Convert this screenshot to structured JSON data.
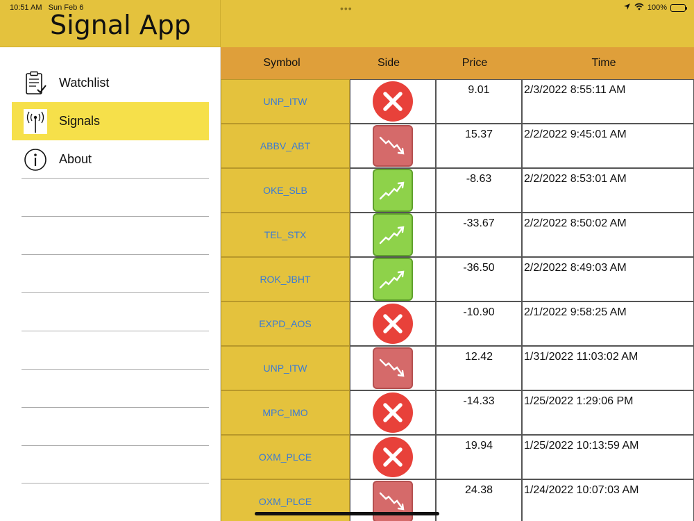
{
  "status_bar": {
    "time": "10:51 AM",
    "date": "Sun Feb 6",
    "battery": "100%"
  },
  "app": {
    "title": "Signal App"
  },
  "sidebar": {
    "items": [
      {
        "label": "Watchlist",
        "icon": "clipboard-icon",
        "active": false
      },
      {
        "label": "Signals",
        "icon": "signal-tower-icon",
        "active": true
      },
      {
        "label": "About",
        "icon": "info-icon",
        "active": false
      }
    ]
  },
  "table": {
    "columns": [
      "Symbol",
      "Side",
      "Price",
      "Time"
    ],
    "rows": [
      {
        "symbol": "UNP_ITW",
        "side": "close",
        "price": "9.01",
        "time": "2/3/2022 8:55:11 AM"
      },
      {
        "symbol": "ABBV_ABT",
        "side": "down",
        "price": "15.37",
        "time": "2/2/2022 9:45:01 AM"
      },
      {
        "symbol": "OKE_SLB",
        "side": "up",
        "price": "-8.63",
        "time": "2/2/2022 8:53:01 AM"
      },
      {
        "symbol": "TEL_STX",
        "side": "up",
        "price": "-33.67",
        "time": "2/2/2022 8:50:02 AM"
      },
      {
        "symbol": "ROK_JBHT",
        "side": "up",
        "price": "-36.50",
        "time": "2/2/2022 8:49:03 AM"
      },
      {
        "symbol": "EXPD_AOS",
        "side": "close",
        "price": "-10.90",
        "time": "2/1/2022 9:58:25 AM"
      },
      {
        "symbol": "UNP_ITW",
        "side": "down",
        "price": "12.42",
        "time": "1/31/2022 11:03:02 AM"
      },
      {
        "symbol": "MPC_IMO",
        "side": "close",
        "price": "-14.33",
        "time": "1/25/2022 1:29:06 PM"
      },
      {
        "symbol": "OXM_PLCE",
        "side": "close",
        "price": "19.94",
        "time": "1/25/2022 10:13:59 AM"
      },
      {
        "symbol": "OXM_PLCE",
        "side": "down",
        "price": "24.38",
        "time": "1/24/2022 10:07:03 AM"
      }
    ]
  },
  "colors": {
    "header": "#e4c23d",
    "table_header": "#df9f3a",
    "active_nav": "#f6e04a",
    "symbol_link": "#3a7bd5",
    "close_red": "#e8413a",
    "down_red": "#d56a6a",
    "up_green": "#8ed24a"
  }
}
